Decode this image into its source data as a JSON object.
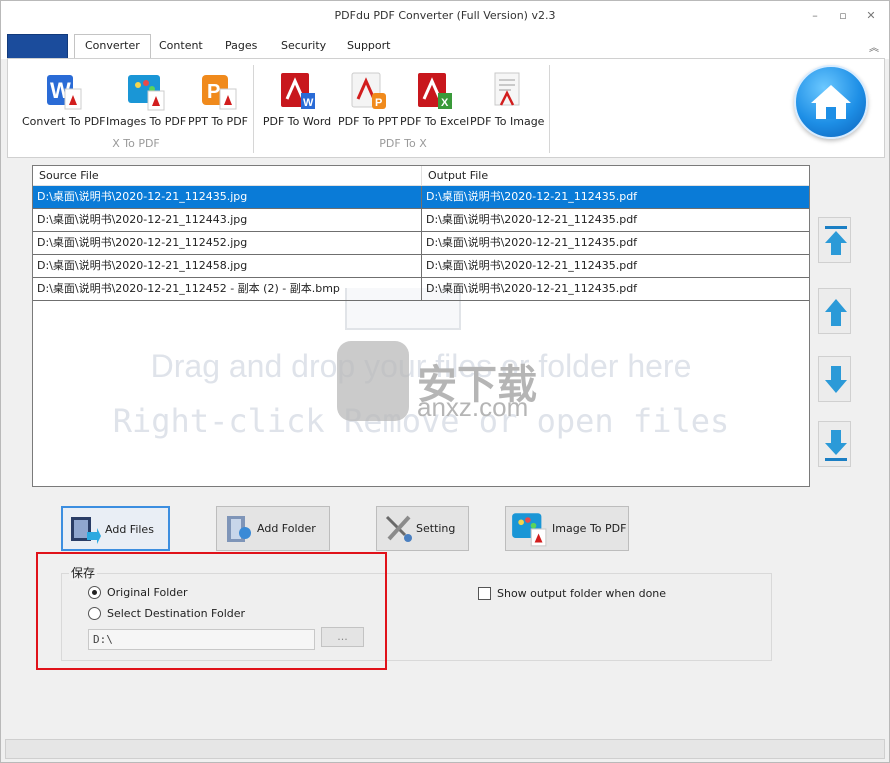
{
  "window": {
    "title": "PDFdu PDF Converter (Full Version) v2.3"
  },
  "tabs": [
    {
      "label": "Converter"
    },
    {
      "label": "Content"
    },
    {
      "label": "Pages"
    },
    {
      "label": "Security"
    },
    {
      "label": "Support"
    }
  ],
  "ribbon": {
    "groups": [
      {
        "label": "X To PDF"
      },
      {
        "label": "PDF To X"
      }
    ],
    "buttons": [
      {
        "label": "Convert To PDF",
        "icon": "word-convert-icon"
      },
      {
        "label": "Images To PDF",
        "icon": "images-pdf-icon"
      },
      {
        "label": "PPT To PDF",
        "icon": "ppt-pdf-icon"
      },
      {
        "label": "PDF To Word",
        "icon": "pdf-word-icon"
      },
      {
        "label": "PDF To PPT",
        "icon": "pdf-ppt-icon"
      },
      {
        "label": "PDF To Excel",
        "icon": "pdf-excel-icon"
      },
      {
        "label": "PDF To Image",
        "icon": "pdf-image-icon"
      }
    ]
  },
  "file_list": {
    "columns": [
      "Source File",
      "Output File"
    ],
    "rows": [
      {
        "source": "D:\\桌面\\说明书\\2020-12-21_112435.jpg",
        "output": "D:\\桌面\\说明书\\2020-12-21_112435.pdf",
        "selected": true
      },
      {
        "source": "D:\\桌面\\说明书\\2020-12-21_112443.jpg",
        "output": "D:\\桌面\\说明书\\2020-12-21_112435.pdf",
        "selected": false
      },
      {
        "source": "D:\\桌面\\说明书\\2020-12-21_112452.jpg",
        "output": "D:\\桌面\\说明书\\2020-12-21_112435.pdf",
        "selected": false
      },
      {
        "source": "D:\\桌面\\说明书\\2020-12-21_112458.jpg",
        "output": "D:\\桌面\\说明书\\2020-12-21_112435.pdf",
        "selected": false
      },
      {
        "source": "D:\\桌面\\说明书\\2020-12-21_112452 - 副本 (2) - 副本.bmp",
        "output": "D:\\桌面\\说明书\\2020-12-21_112435.pdf",
        "selected": false
      }
    ],
    "hint_line1": "Drag and drop your files or folder here",
    "hint_line2": "Right-click Remove or open files",
    "watermark_cn": "安下载",
    "watermark_domain": "anxz.com"
  },
  "actions": [
    {
      "label": "Add Files",
      "icon": "add-files-icon"
    },
    {
      "label": "Add Folder",
      "icon": "add-folder-icon"
    },
    {
      "label": "Setting",
      "icon": "tools-icon"
    },
    {
      "label": "Image To PDF",
      "icon": "image-pdf-icon"
    }
  ],
  "save": {
    "title": "保存",
    "option_original": "Original Folder",
    "option_select": "Select Destination Folder",
    "selected_option": "original",
    "path_value": "D:\\",
    "browse_label": "...",
    "show_output_label": "Show output folder when done",
    "show_output_checked": false
  },
  "colors": {
    "selection": "#0a7bd7",
    "highlight_box": "#e0121a",
    "app_button": "#1b4c9c"
  }
}
